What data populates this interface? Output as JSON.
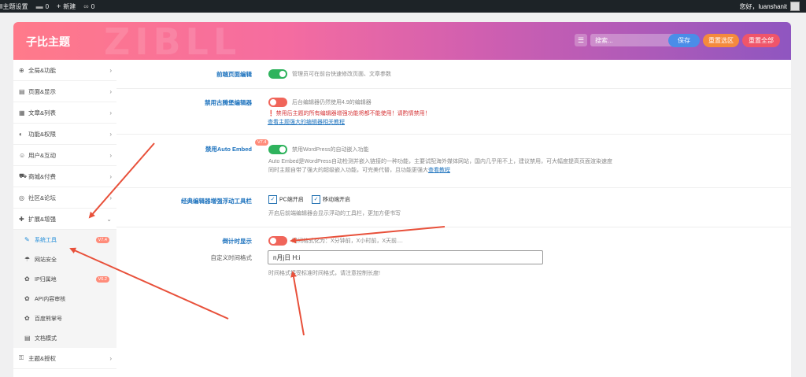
{
  "adminbar": {
    "site_name": "ll主题设置",
    "comments": "0",
    "new_label": "新建",
    "updates": "0",
    "greeting": "您好，luanshanit"
  },
  "header": {
    "title": "子比主题",
    "watermark": "ZIBLL",
    "search_placeholder": "搜索...",
    "save_label": "保存",
    "reset_section_label": "重置选区",
    "reset_all_label": "重置全部"
  },
  "sidebar": {
    "items": [
      {
        "icon": "globe-icon",
        "glyph": "⊕",
        "label": "全局&功能"
      },
      {
        "icon": "page-icon",
        "glyph": "▤",
        "label": "页面&显示"
      },
      {
        "icon": "map-icon",
        "glyph": "▦",
        "label": "文章&列表"
      },
      {
        "icon": "shield-icon",
        "glyph": "◐",
        "label": "功能&权限"
      },
      {
        "icon": "user-icon",
        "glyph": "☺",
        "label": "用户&互动"
      },
      {
        "icon": "cart-icon",
        "glyph": "⛟",
        "label": "商城&付费"
      },
      {
        "icon": "chat-icon",
        "glyph": "◎",
        "label": "社区&论坛"
      },
      {
        "icon": "puzzle-icon",
        "glyph": "✚",
        "label": "扩展&增强"
      }
    ],
    "subitems": [
      {
        "icon": "wrench-icon",
        "glyph": "✎",
        "label": "系统工具",
        "badge": "V7.4",
        "active": true
      },
      {
        "icon": "umbrella-icon",
        "glyph": "☂",
        "label": "网站安全",
        "badge": "",
        "active": false
      },
      {
        "icon": "paw-icon",
        "glyph": "✿",
        "label": "IP归属地",
        "badge": "V6.2",
        "active": false
      },
      {
        "icon": "paw-icon",
        "glyph": "✿",
        "label": "API内容审核",
        "badge": "",
        "active": false
      },
      {
        "icon": "paw-icon",
        "glyph": "✿",
        "label": "百度熊掌号",
        "badge": "",
        "active": false
      },
      {
        "icon": "doc-icon",
        "glyph": "▤",
        "label": "文档模式",
        "badge": "",
        "active": false
      }
    ],
    "bottom_item": {
      "icon": "key-icon",
      "glyph": "⚿",
      "label": "主题&授权"
    }
  },
  "settings": {
    "frontend_edit": {
      "label": "前端页面编辑",
      "desc": "管理员可在前台快速修改页面、文章参数",
      "enabled": true
    },
    "classic_editor": {
      "label": "禁用古腾堡编辑器",
      "desc": "后台编辑器仍然使用4.9的编辑器",
      "warning": "❗ 禁用后主题的所有编辑器增强功能将都不能使用！请酌情禁用！",
      "link": "查看主题强大的编辑器相关教程",
      "enabled": false
    },
    "auto_embed": {
      "label": "禁用Auto Embed",
      "badge": "V7.4",
      "desc": "禁用WordPress的自动嵌入功能",
      "detail_line1": "Auto Embed是WordPress自动检测并嵌入链接的一种功能，主要试配海外媒体网站，国内几乎用不上，建议禁用，可大幅度提高页面渲染速度",
      "detail_line2": "同时主题自带了强大的超级嵌入功能，可完美代替，且功能更强大",
      "detail_link": "查看教程",
      "enabled": true
    },
    "toolbar": {
      "label": "经典编辑器增强浮动工具栏",
      "pc_label": "PC端开启",
      "mobile_label": "移动端开启",
      "pc_checked": true,
      "mobile_checked": true,
      "desc": "开启后前端编辑器会显示浮动的工具栏，更加方便书写"
    },
    "countdown": {
      "label": "倒计时显示",
      "desc": "时间格式化为：X分钟前，X小时前，X天前....",
      "enabled": false
    },
    "time_format": {
      "label": "自定义时间格式",
      "value": "n月j日 H:i",
      "hint": "时间格式接受标准时间格式，请注意控制长度!"
    }
  },
  "colors": {
    "toggle_on": "#2fb35d",
    "toggle_off": "#f0655a",
    "annotation_arrow": "#e8503a",
    "link": "#1e73be",
    "save_btn": "#4a8de8",
    "reset_section_btn": "#f58a3c",
    "reset_all_btn": "#f0556a"
  }
}
